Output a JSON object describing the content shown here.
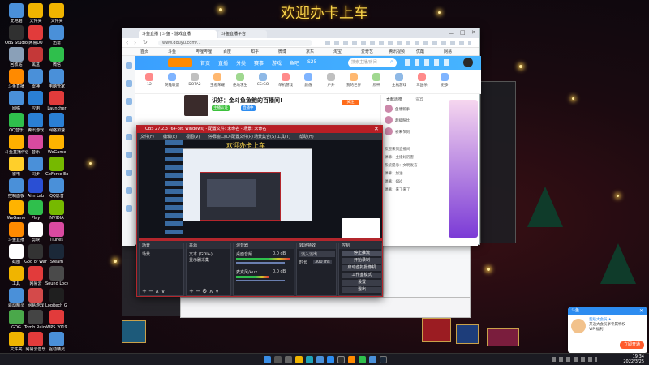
{
  "wallpaper": {
    "title": "欢迎办卡上车"
  },
  "desktop_icons": [
    {
      "label": "此电脑",
      "color": "#4a90d9"
    },
    {
      "label": "OBS Studio",
      "color": "#303030"
    },
    {
      "label": "回收站",
      "color": "#8aa0b8"
    },
    {
      "label": "斗鱼直播",
      "color": "#ff8a00"
    },
    {
      "label": "网络",
      "color": "#4a90d9"
    },
    {
      "label": "QQ音乐",
      "color": "#2fbf4c"
    },
    {
      "label": "斗鱼直播伴侣",
      "color": "#ffb000"
    },
    {
      "label": "雷电",
      "color": "#ffcf2a"
    },
    {
      "label": "控制面板",
      "color": "#4a90d9"
    },
    {
      "label": "WeGame",
      "color": "#ffb300"
    },
    {
      "label": "斗鱼直播",
      "color": "#ff8a00"
    },
    {
      "label": "截图",
      "color": "#ffffff"
    },
    {
      "label": "工具",
      "color": "#f0b400"
    },
    {
      "label": "驱动精灵",
      "color": "#4a90d9"
    },
    {
      "label": "GOG",
      "color": "#4aa84a"
    },
    {
      "label": "文件夹",
      "color": "#f0b400"
    },
    {
      "label": "文件夹",
      "color": "#f0b400"
    },
    {
      "label": "网易UU",
      "color": "#e23b3b"
    },
    {
      "label": "黑盒",
      "color": "#c43838"
    },
    {
      "label": "雷神",
      "color": "#4a90d9"
    },
    {
      "label": "应用",
      "color": "#2a7fd4"
    },
    {
      "label": "腾讯游戏",
      "color": "#2a7fd4"
    },
    {
      "label": "音乐",
      "color": "#d94aa0"
    },
    {
      "label": "同步",
      "color": "#4a90d9"
    },
    {
      "label": "Aim Lab",
      "color": "#2a4fd4"
    },
    {
      "label": "Play",
      "color": "#2fbf4c"
    },
    {
      "label": "剪映",
      "color": "#ffffff"
    },
    {
      "label": "God of War",
      "color": "#333333"
    },
    {
      "label": "网易云",
      "color": "#e23b3b"
    },
    {
      "label": "网易游戏",
      "color": "#d44a4a"
    },
    {
      "label": "Tomb Raider",
      "color": "#444444"
    },
    {
      "label": "网易云音乐",
      "color": "#e23b3b"
    },
    {
      "label": "文件夹",
      "color": "#f0b400"
    },
    {
      "label": "迅雷",
      "color": "#4a90d9"
    },
    {
      "label": "微信",
      "color": "#2fbf4c"
    },
    {
      "label": "电脑管家",
      "color": "#4a90d9"
    },
    {
      "label": "Launcher",
      "color": "#e23b3b"
    },
    {
      "label": "网络加速",
      "color": "#2a7fd4"
    },
    {
      "label": "WeGame",
      "color": "#ffb300"
    },
    {
      "label": "GeForce Experience",
      "color": "#76b900"
    },
    {
      "label": "QQ影音",
      "color": "#4a90d9"
    },
    {
      "label": "NVIDIA",
      "color": "#76b900"
    },
    {
      "label": "iTunes",
      "color": "#d94aa0"
    },
    {
      "label": "Steam",
      "color": "#1b2838"
    },
    {
      "label": "Sound Lock",
      "color": "#4a4a4a"
    },
    {
      "label": "Logitech G HUB",
      "color": "#1f1f1f"
    },
    {
      "label": "WPS 2019",
      "color": "#e23b3b"
    },
    {
      "label": "驱动精灵",
      "color": "#4a90d9"
    }
  ],
  "browser": {
    "tabs": [
      "斗鱼直播 | 斗鱼 - 游戏直播",
      "斗鱼直播平台"
    ],
    "url": "www.douyu.com/...",
    "bookmarks": [
      "首页",
      "斗鱼",
      "哔哩哔哩",
      "百度",
      "知乎",
      "微博",
      "京东",
      "淘宝",
      "爱奇艺",
      "腾讯视频",
      "优酷",
      "网易"
    ],
    "site_nav": [
      "首页",
      "直播",
      "分类",
      "赛事",
      "游戏",
      "鱼吧",
      "S25"
    ],
    "search_placeholder": "搜索主播/房间",
    "categories": [
      "12",
      "英雄联盟",
      "DOTA2",
      "王者荣耀",
      "绝地求生",
      "CS:GO",
      "单机游戏",
      "颜值",
      "户外",
      "我的世界",
      "原神",
      "主机游戏",
      "三国杀",
      "更多"
    ],
    "room_title": "识好：金斗鱼鱼鲍的百播间!",
    "room_badges": [
      "主播认证",
      "直播中",
      "关注"
    ],
    "right_panel": {
      "tab_labels": [
        "贡献周榜",
        "贵宾"
      ],
      "ranks": [
        "鱼塘新手",
        "超级粉丝",
        "初来乍到"
      ],
      "chat": [
        "欢迎来到直播间",
        "弹幕：主播好厉害",
        "系统提示：文明发言",
        "弹幕：加油",
        "弹幕：666",
        "弹幕：来了来了"
      ]
    },
    "left_rail_count": 9
  },
  "obs": {
    "title": "OBS 27.2.3 (64-bit, windows) - 配置文件: 未命名 - 场景: 未命名",
    "menu": [
      "文件(F)",
      "编辑(E)",
      "视图(V)",
      "停靠窗口(D)",
      "配置文件(P)",
      "场景集合(S)",
      "工具(T)",
      "帮助(H)"
    ],
    "docks": {
      "scenes": {
        "title": "场景",
        "items": [
          "场景"
        ]
      },
      "sources": {
        "title": "来源",
        "items": [
          "文本 (GDI+)",
          "显示器采集"
        ]
      },
      "mixer": {
        "title": "混音器",
        "items": [
          "桌面音频",
          "麦克风/Aux"
        ],
        "levels": [
          "0.0 dB",
          "0.0 dB"
        ]
      },
      "transitions": {
        "title": "转场特效",
        "items": [
          "淡入淡出",
          "时长",
          "300 ms"
        ]
      },
      "controls": {
        "title": "控制",
        "buttons": [
          "停止推流",
          "开始录制",
          "启动虚拟摄像机",
          "工作室模式",
          "设置",
          "退出"
        ]
      }
    }
  },
  "notification": {
    "title": "斗鱼",
    "body": [
      "超级大会员 ✦",
      "开通大会员享专属特权",
      "VIP 福利"
    ],
    "button": "立即开通"
  },
  "taskbar": {
    "time": "19:34",
    "date": "2022/3/25"
  }
}
